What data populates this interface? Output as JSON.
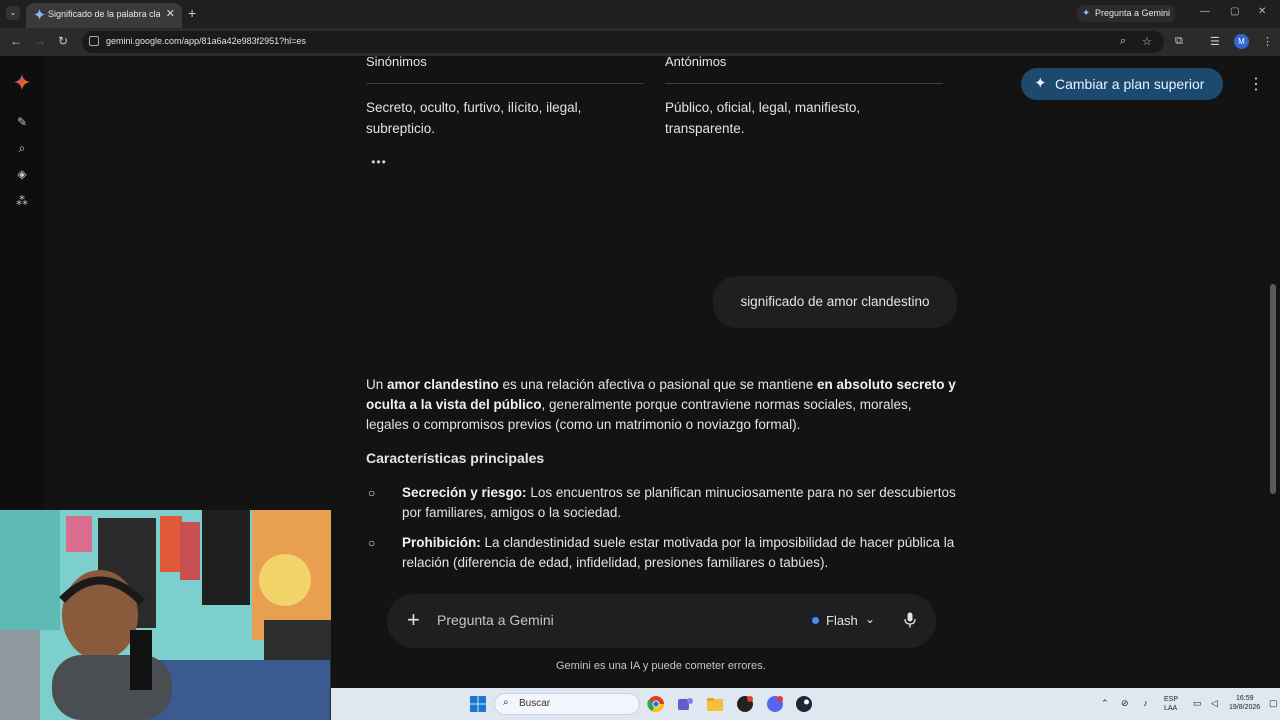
{
  "browser": {
    "tab_title": "Significado de la palabra clandestino",
    "ask_gemini": "Pregunta a Gemini",
    "url": "gemini.google.com/app/81a6a42e983f2951?hl=es",
    "profile_initial": "M"
  },
  "header": {
    "upgrade_label": "Cambiar a plan superior"
  },
  "table": {
    "col1_header": "Sinónimos",
    "col2_header": "Antónimos",
    "col1_line1": "Secreto, oculto, furtivo, ilícito, ilegal,",
    "col1_line2": "subrepticio.",
    "col2_line1": "Público, oficial, legal, manifiesto,",
    "col2_line2": "transparente."
  },
  "user_prompt": "significado de amor clandestino",
  "answer": {
    "p1": "Un ",
    "p1_b1": "amor clandestino",
    "p2": " es una relación afectiva o pasional que se mantiene ",
    "p2_b2": "en absoluto secreto y oculta a la vista del público",
    "p3": ", generalmente porque contraviene normas sociales, morales, legales o compromisos previos (como un matrimonio o noviazgo formal).",
    "features_heading": "Características principales",
    "items": [
      {
        "title": "Secreción y riesgo:",
        "text": " Los encuentros se planifican minuciosamente para no ser descubiertos por familiares, amigos o la sociedad."
      },
      {
        "title": "Prohibición:",
        "text": " La clandestinidad suele estar motivada por la imposibilidad de hacer pública la relación (diferencia de edad, infidelidad, presiones familiares o tabúes)."
      }
    ]
  },
  "input": {
    "placeholder": "Pregunta a Gemini",
    "mode": "Flash"
  },
  "disclaimer": "Gemini es una IA y puede cometer errores.",
  "taskbar": {
    "search_label": "Buscar",
    "lang1": "ESP",
    "lang2": "LAA",
    "time": "16:59",
    "date": "19/8/2026"
  },
  "colors": {
    "upgrade_bg": "#1c4a6e",
    "flash_dot": "#4a8cf7",
    "accent": "#8ab4f8"
  }
}
